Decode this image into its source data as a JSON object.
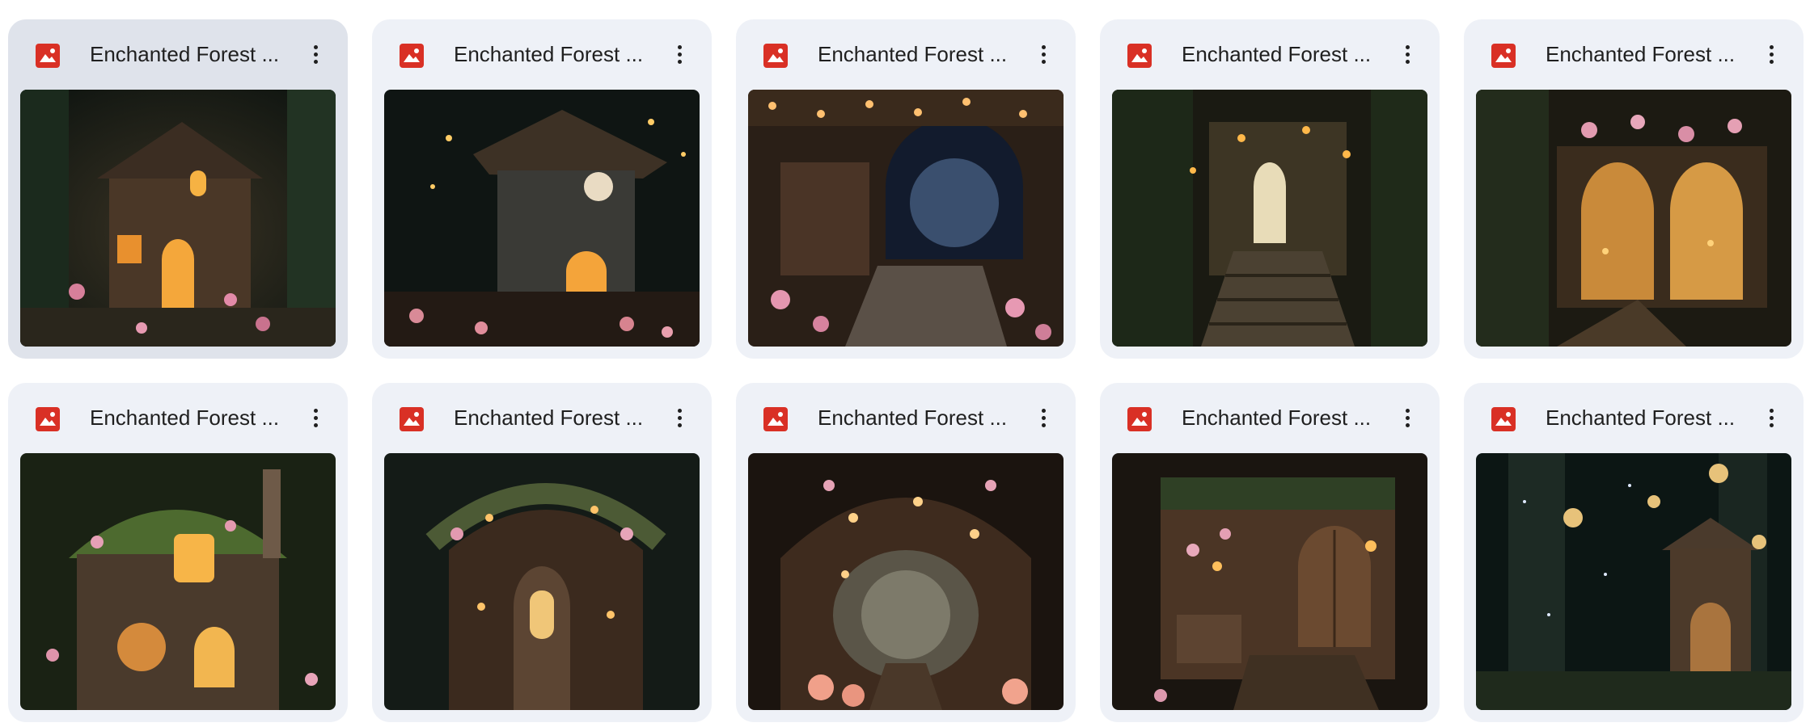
{
  "colors": {
    "card_bg": "#eef1f7",
    "card_selected_bg": "#dfe3eb",
    "image_icon": "#d93025",
    "title_text": "#1f1f1f"
  },
  "files": [
    {
      "name": "Enchanted Forest ...",
      "icon": "image-file-icon",
      "selected": true,
      "scene": "cottage"
    },
    {
      "name": "Enchanted Forest ...",
      "icon": "image-file-icon",
      "selected": false,
      "scene": "round-window-house"
    },
    {
      "name": "Enchanted Forest ...",
      "icon": "image-file-icon",
      "selected": false,
      "scene": "stone-archway"
    },
    {
      "name": "Enchanted Forest ...",
      "icon": "image-file-icon",
      "selected": false,
      "scene": "arched-door-stairs"
    },
    {
      "name": "Enchanted Forest ...",
      "icon": "image-file-icon",
      "selected": false,
      "scene": "double-archway"
    },
    {
      "name": "Enchanted Forest ...",
      "icon": "image-file-icon",
      "selected": false,
      "scene": "mossy-cottage"
    },
    {
      "name": "Enchanted Forest ...",
      "icon": "image-file-icon",
      "selected": false,
      "scene": "tree-door"
    },
    {
      "name": "Enchanted Forest ...",
      "icon": "image-file-icon",
      "selected": false,
      "scene": "blossom-tunnel"
    },
    {
      "name": "Enchanted Forest ...",
      "icon": "image-file-icon",
      "selected": false,
      "scene": "wooden-round-door"
    },
    {
      "name": "Enchanted Forest ...",
      "icon": "image-file-icon",
      "selected": false,
      "scene": "night-fairy-house"
    }
  ]
}
